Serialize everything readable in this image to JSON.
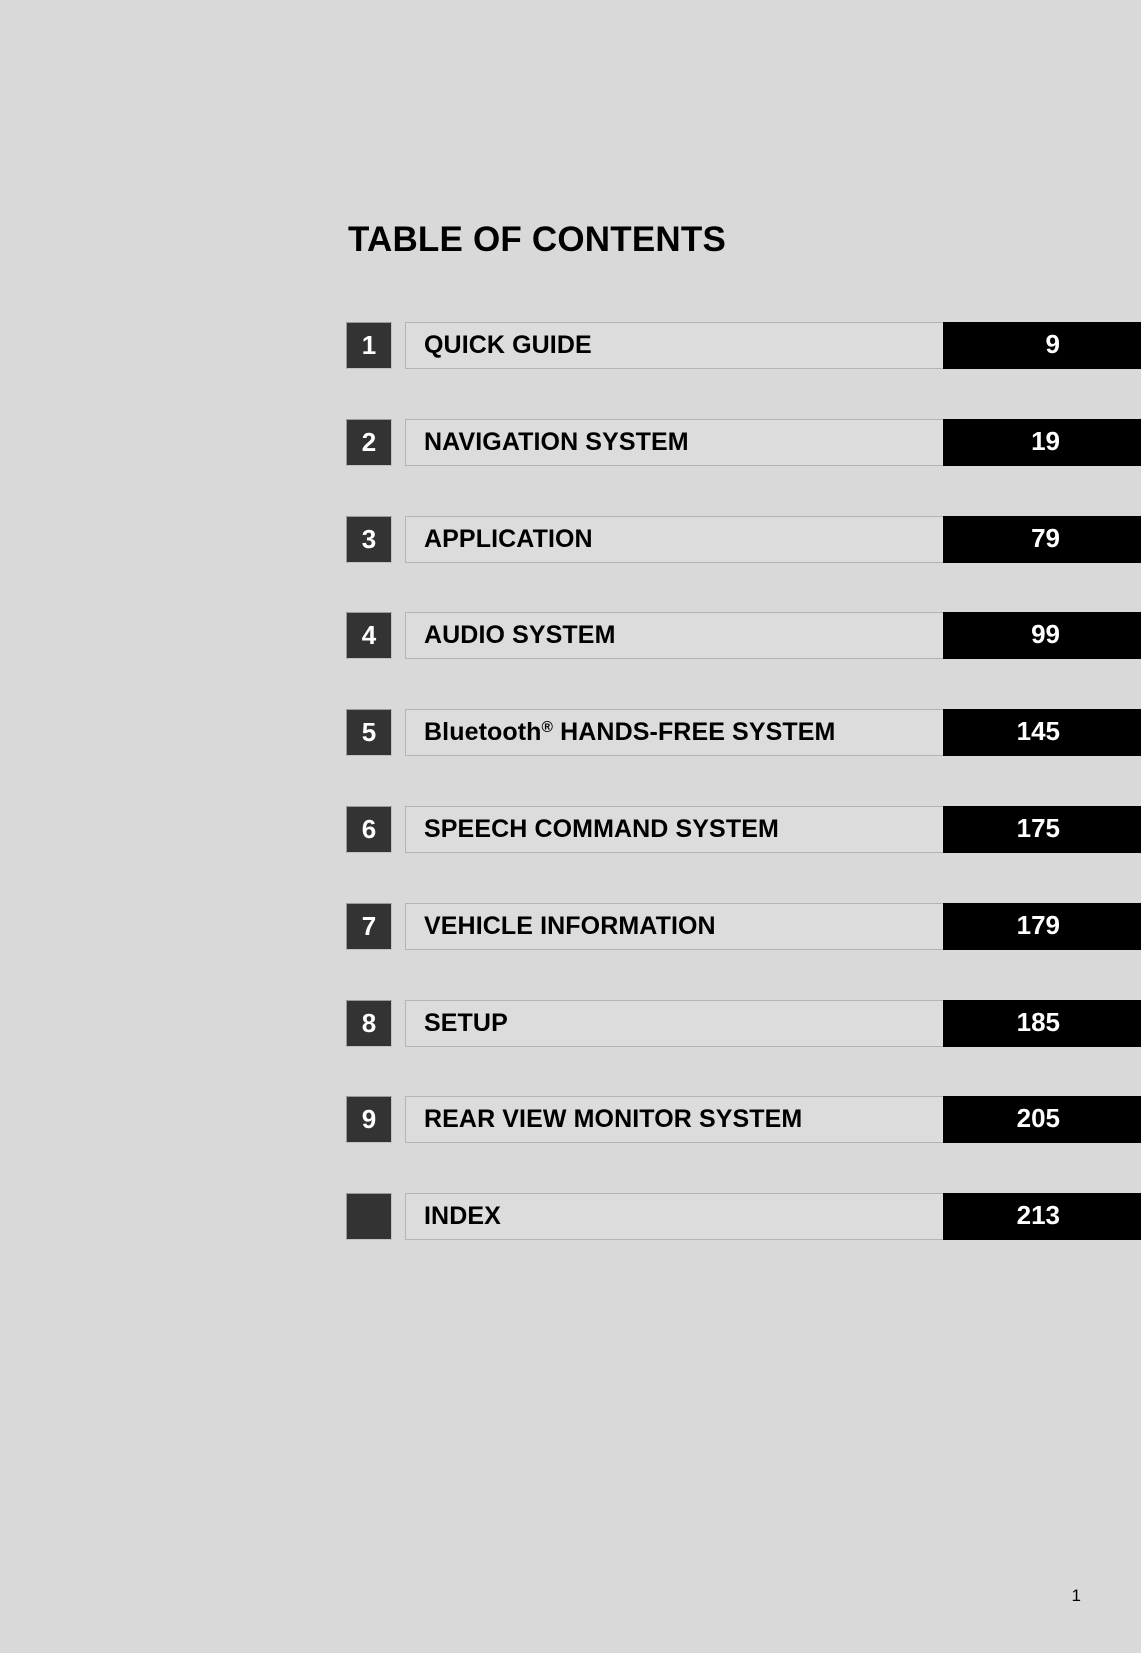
{
  "document": {
    "title": "TABLE OF CONTENTS",
    "folio": "1",
    "background_color": "#d9d9d9",
    "accent_dark": "#333333",
    "page_bar_color": "#000000",
    "label_plate_color": "#dcdcdc"
  },
  "contents": {
    "rows": [
      {
        "number": "1",
        "label": "QUICK GUIDE",
        "label_sup": "",
        "label_tail": "",
        "page": "9"
      },
      {
        "number": "2",
        "label": "NAVIGATION SYSTEM",
        "label_sup": "",
        "label_tail": "",
        "page": "19"
      },
      {
        "number": "3",
        "label": "APPLICATION",
        "label_sup": "",
        "label_tail": "",
        "page": "79"
      },
      {
        "number": "4",
        "label": "AUDIO SYSTEM",
        "label_sup": "",
        "label_tail": "",
        "page": "99"
      },
      {
        "number": "5",
        "label": "Bluetooth",
        "label_sup": "®",
        "label_tail": " HANDS-FREE SYSTEM",
        "page": "145"
      },
      {
        "number": "6",
        "label": "SPEECH COMMAND SYSTEM",
        "label_sup": "",
        "label_tail": "",
        "page": "175"
      },
      {
        "number": "7",
        "label": "VEHICLE INFORMATION",
        "label_sup": "",
        "label_tail": "",
        "page": "179"
      },
      {
        "number": "8",
        "label": "SETUP",
        "label_sup": "",
        "label_tail": "",
        "page": "185"
      },
      {
        "number": "9",
        "label": "REAR VIEW MONITOR SYSTEM",
        "label_sup": "",
        "label_tail": "",
        "page": "205"
      },
      {
        "number": "",
        "label": "INDEX",
        "label_sup": "",
        "label_tail": "",
        "page": "213"
      }
    ]
  }
}
